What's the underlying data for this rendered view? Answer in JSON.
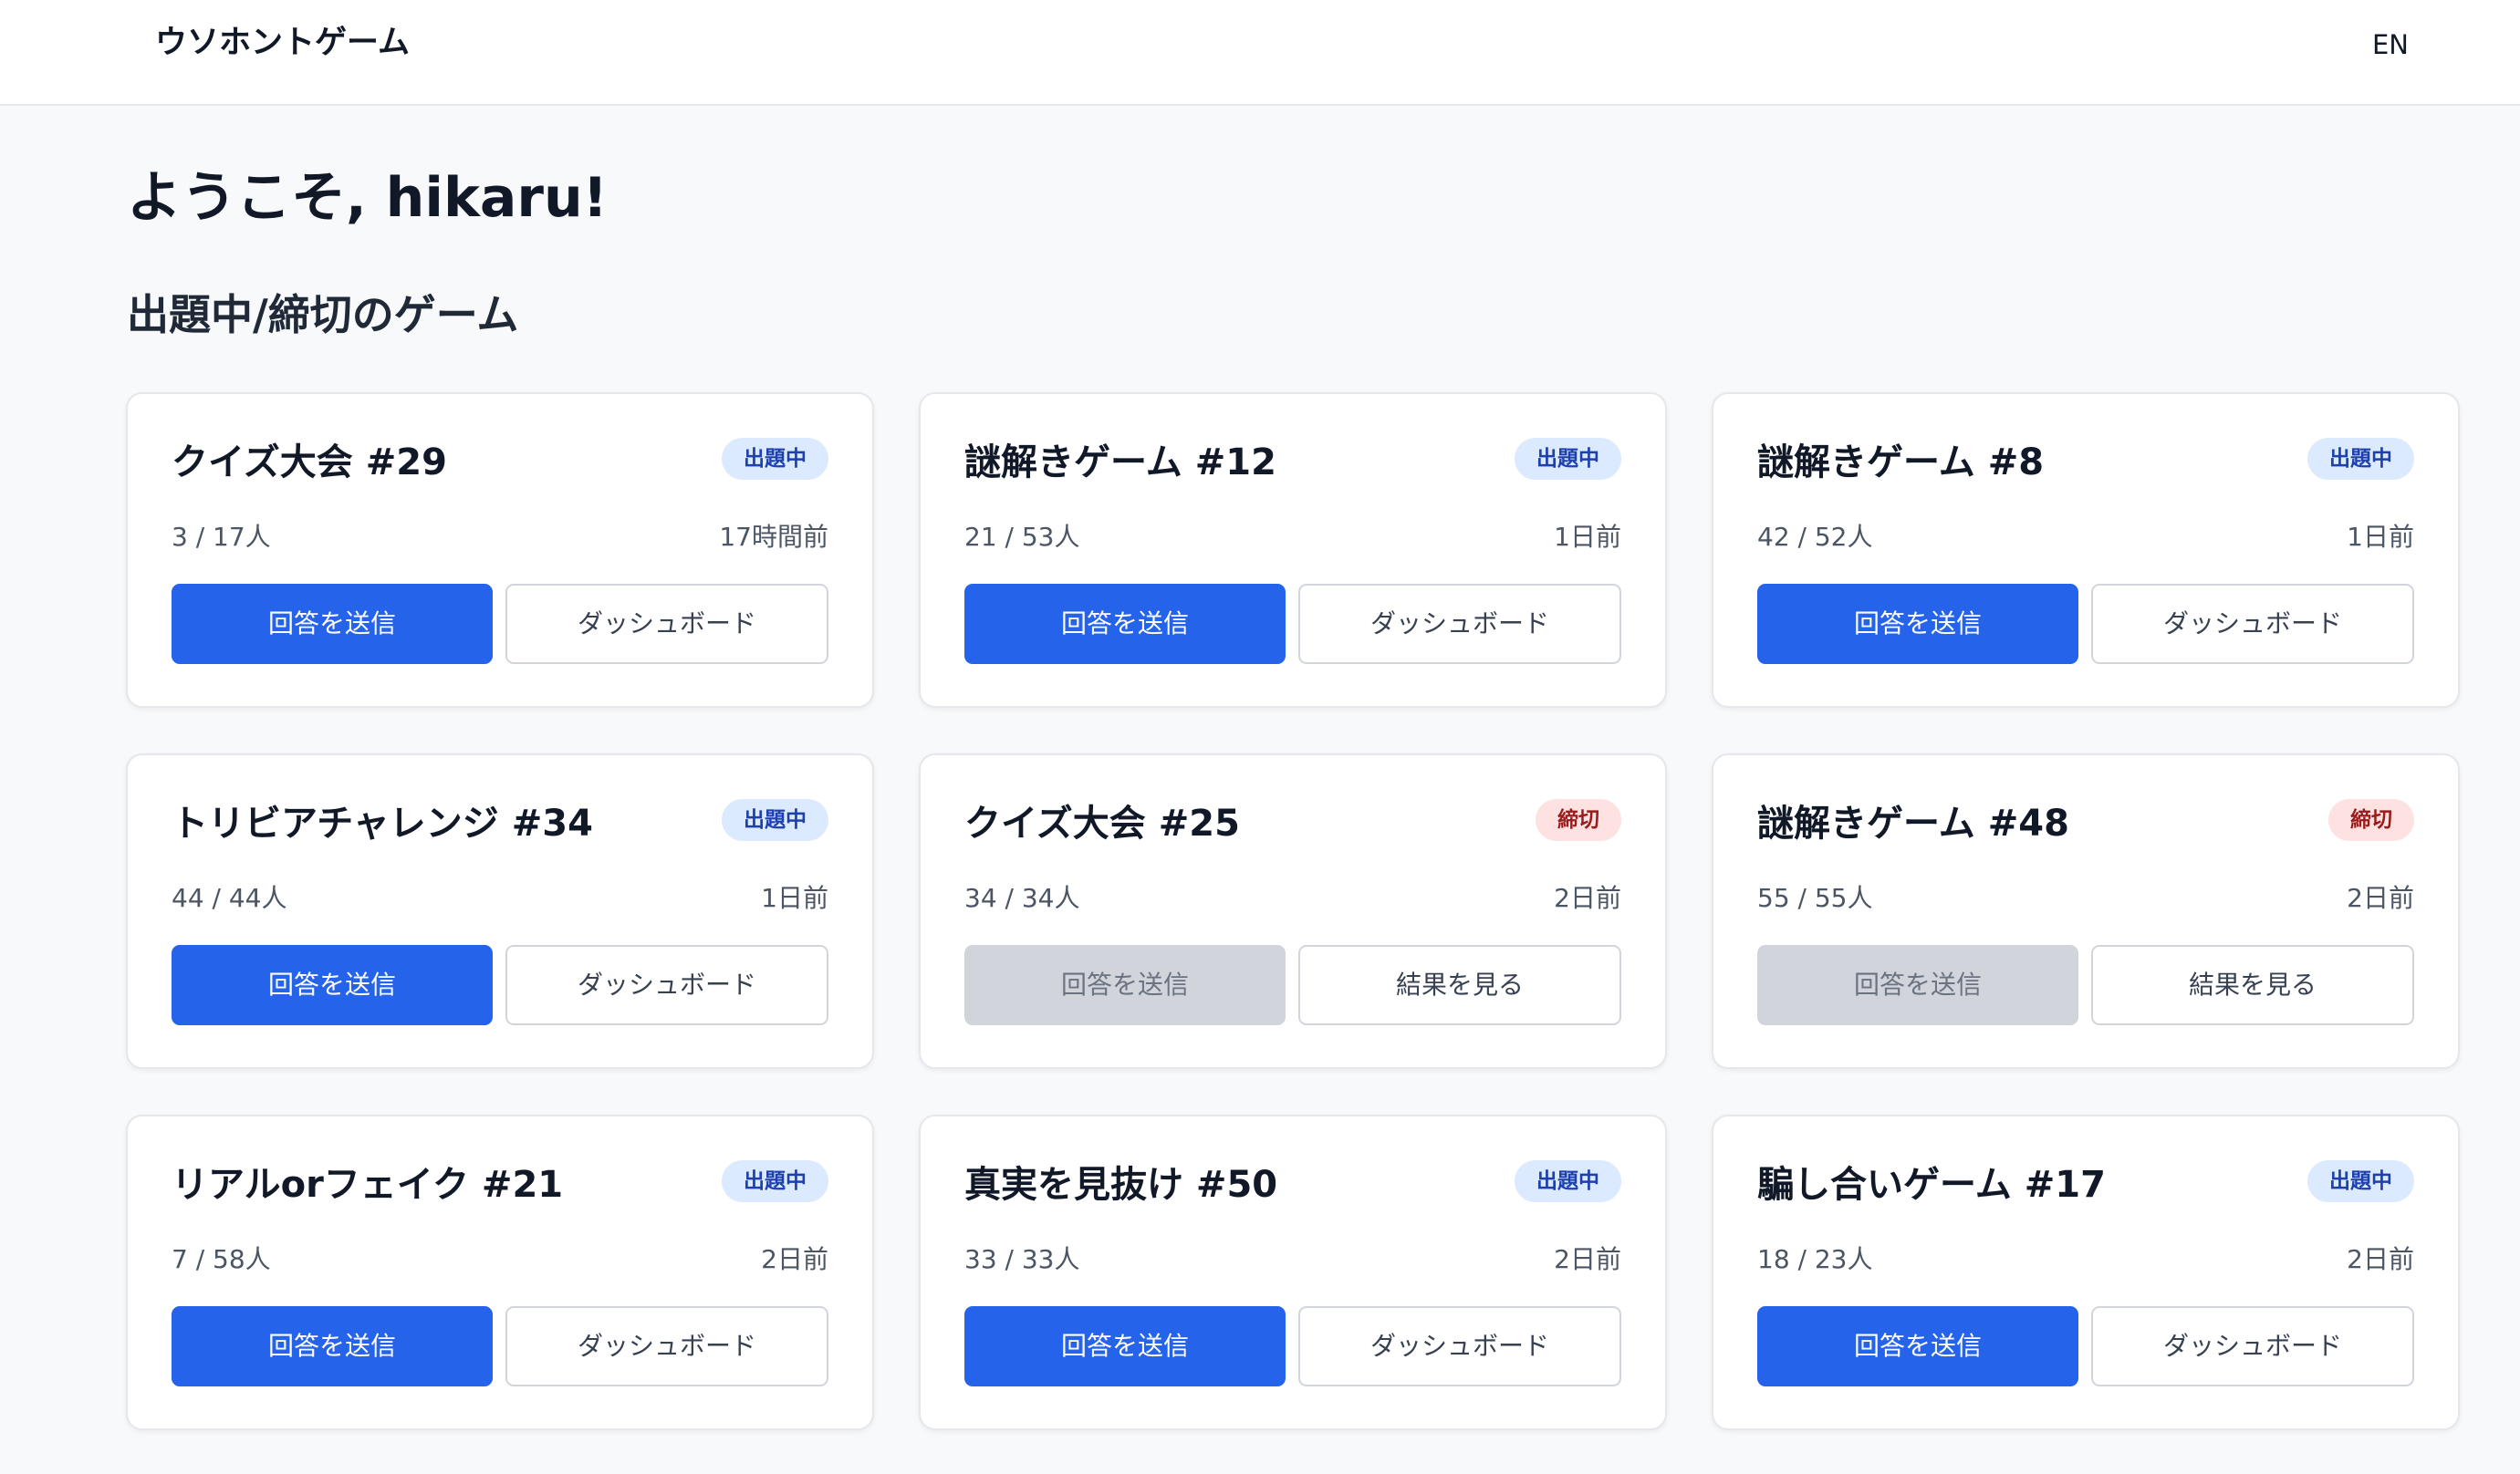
{
  "header": {
    "brand": "ウソホントゲーム",
    "language": "EN"
  },
  "welcome": "ようこそ, hikaru!",
  "section_title": "出題中/締切のゲーム",
  "status_colors": {
    "open_badge_bg": "#dbeafe",
    "open_badge_text": "#1e40af",
    "closed_badge_bg": "#fee2e2",
    "closed_badge_text": "#991b1b",
    "primary_button": "#2563eb",
    "disabled_button": "#d1d5db"
  },
  "games": [
    {
      "title": "クイズ大会 #29",
      "status": "出題中",
      "status_type": "open",
      "participants": "3 / 17人",
      "time": "17時間前",
      "primary_label": "回答を送信",
      "primary_disabled": false,
      "secondary_label": "ダッシュボード"
    },
    {
      "title": "謎解きゲーム #12",
      "status": "出題中",
      "status_type": "open",
      "participants": "21 / 53人",
      "time": "1日前",
      "primary_label": "回答を送信",
      "primary_disabled": false,
      "secondary_label": "ダッシュボード"
    },
    {
      "title": "謎解きゲーム #8",
      "status": "出題中",
      "status_type": "open",
      "participants": "42 / 52人",
      "time": "1日前",
      "primary_label": "回答を送信",
      "primary_disabled": false,
      "secondary_label": "ダッシュボード"
    },
    {
      "title": "トリビアチャレンジ #34",
      "status": "出題中",
      "status_type": "open",
      "participants": "44 / 44人",
      "time": "1日前",
      "primary_label": "回答を送信",
      "primary_disabled": false,
      "secondary_label": "ダッシュボード"
    },
    {
      "title": "クイズ大会 #25",
      "status": "締切",
      "status_type": "closed",
      "participants": "34 / 34人",
      "time": "2日前",
      "primary_label": "回答を送信",
      "primary_disabled": true,
      "secondary_label": "結果を見る"
    },
    {
      "title": "謎解きゲーム #48",
      "status": "締切",
      "status_type": "closed",
      "participants": "55 / 55人",
      "time": "2日前",
      "primary_label": "回答を送信",
      "primary_disabled": true,
      "secondary_label": "結果を見る"
    },
    {
      "title": "リアルorフェイク #21",
      "status": "出題中",
      "status_type": "open",
      "participants": "7 / 58人",
      "time": "2日前",
      "primary_label": "回答を送信",
      "primary_disabled": false,
      "secondary_label": "ダッシュボード"
    },
    {
      "title": "真実を見抜け #50",
      "status": "出題中",
      "status_type": "open",
      "participants": "33 / 33人",
      "time": "2日前",
      "primary_label": "回答を送信",
      "primary_disabled": false,
      "secondary_label": "ダッシュボード"
    },
    {
      "title": "騙し合いゲーム #17",
      "status": "出題中",
      "status_type": "open",
      "participants": "18 / 23人",
      "time": "2日前",
      "primary_label": "回答を送信",
      "primary_disabled": false,
      "secondary_label": "ダッシュボード"
    }
  ]
}
